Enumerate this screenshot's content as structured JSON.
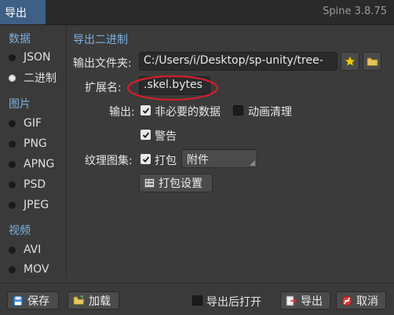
{
  "window": {
    "tab_title": "导出",
    "app_version": "Spine 3.8.75"
  },
  "sidebar": {
    "data_section": "数据",
    "data_options": [
      {
        "label": "JSON",
        "selected": false
      },
      {
        "label": "二进制",
        "selected": true
      }
    ],
    "image_section": "图片",
    "image_options": [
      {
        "label": "GIF"
      },
      {
        "label": "PNG"
      },
      {
        "label": "APNG"
      },
      {
        "label": "PSD"
      },
      {
        "label": "JPEG"
      }
    ],
    "video_section": "视频",
    "video_options": [
      {
        "label": "AVI"
      },
      {
        "label": "MOV"
      }
    ]
  },
  "main": {
    "title": "导出二进制",
    "output_folder": {
      "label": "输出文件夹:",
      "value": "C:/Users/i/Desktop/sp-unity/tree-"
    },
    "extension": {
      "label": "扩展名:",
      "value": ".skel.bytes"
    },
    "output": {
      "label": "输出:",
      "nonessential": {
        "label": "非必要的数据",
        "checked": true
      },
      "animation_cleanup": {
        "label": "动画清理",
        "checked": false
      },
      "warnings": {
        "label": "警告",
        "checked": true
      }
    },
    "texture_atlas": {
      "label": "纹理图集:",
      "pack": {
        "label": "打包",
        "checked": true
      },
      "mode": "附件",
      "pack_settings_button": "打包设置"
    }
  },
  "footer": {
    "save_button": "保存",
    "load_button": "加载",
    "open_after_export": {
      "label": "导出后打开",
      "checked": false
    },
    "export_button": "导出",
    "cancel_button": "取消"
  },
  "colors": {
    "accent": "#7fb0e0",
    "tab_active": "#3e5f86",
    "annotation": "#d0202c"
  }
}
